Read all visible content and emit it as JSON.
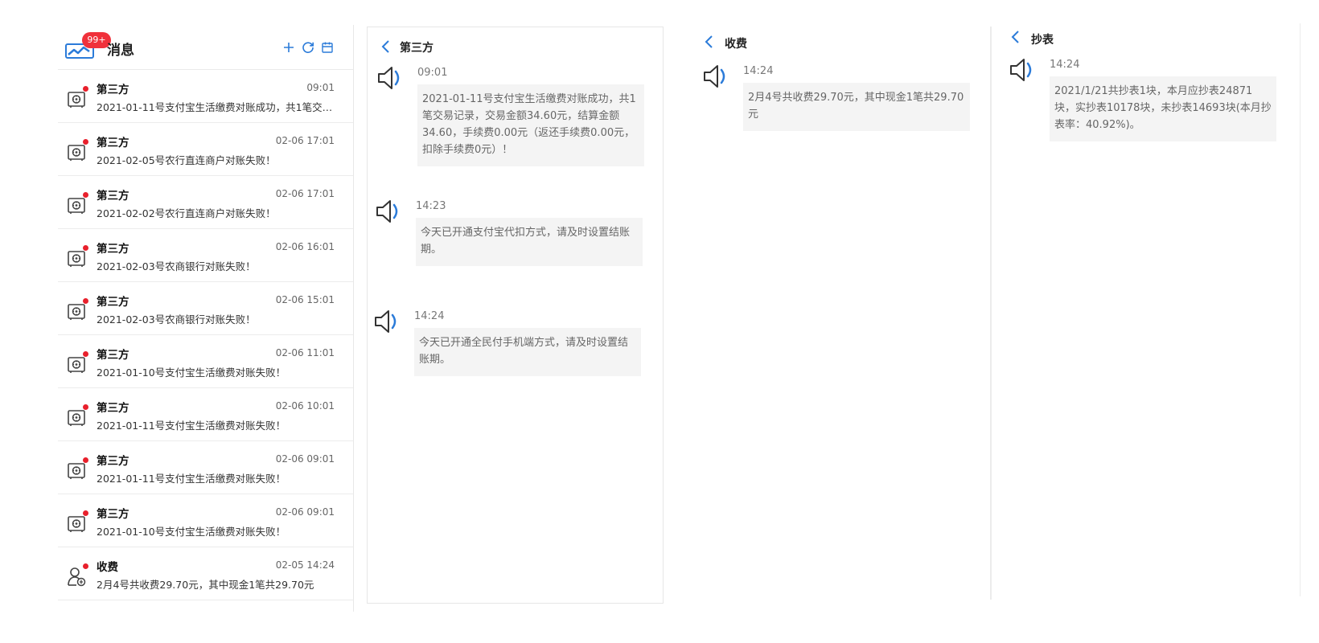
{
  "header": {
    "title": "消息",
    "unread_badge": "99+",
    "actions": [
      {
        "name": "add-button",
        "icon": "plus-icon"
      },
      {
        "name": "refresh-button",
        "icon": "refresh-icon"
      },
      {
        "name": "calendar-button",
        "icon": "calendar-icon"
      }
    ]
  },
  "colors": {
    "accent": "#2b7bd9",
    "badge": "#f0313b",
    "unread_dot": "#e8202c",
    "bubble_bg": "#f4f4f4"
  },
  "messages": [
    {
      "title": "第三方",
      "time": "09:01",
      "text": "2021-01-11号支付宝生活缴费对账成功，共1笔交易记录，交易金额34.60元，结算金额34.60，手续费0.00元（返还手续费0.00元，扣除手续费0元）！",
      "icon": "safe-icon"
    },
    {
      "title": "第三方",
      "time": "02-06 17:01",
      "text": "2021-02-05号农行直连商户对账失败！",
      "icon": "safe-icon"
    },
    {
      "title": "第三方",
      "time": "02-06 17:01",
      "text": "2021-02-02号农行直连商户对账失败！",
      "icon": "safe-icon"
    },
    {
      "title": "第三方",
      "time": "02-06 16:01",
      "text": "2021-02-03号农商银行对账失败！",
      "icon": "safe-icon"
    },
    {
      "title": "第三方",
      "time": "02-06 15:01",
      "text": "2021-02-03号农商银行对账失败！",
      "icon": "safe-icon"
    },
    {
      "title": "第三方",
      "time": "02-06 11:01",
      "text": "2021-01-10号支付宝生活缴费对账失败！",
      "icon": "safe-icon"
    },
    {
      "title": "第三方",
      "time": "02-06 10:01",
      "text": "2021-01-11号支付宝生活缴费对账失败！",
      "icon": "safe-icon"
    },
    {
      "title": "第三方",
      "time": "02-06 09:01",
      "text": "2021-01-11号支付宝生活缴费对账失败！",
      "icon": "safe-icon"
    },
    {
      "title": "第三方",
      "time": "02-06 09:01",
      "text": "2021-01-10号支付宝生活缴费对账失败！",
      "icon": "safe-icon"
    },
    {
      "title": "收费",
      "time": "02-05 14:24",
      "text": "2月4号共收费29.70元，其中现金1笔共29.70元",
      "icon": "user-coin-icon"
    }
  ],
  "panels": [
    {
      "title": "第三方",
      "bubbles": [
        {
          "time": "09:01",
          "text": "2021-01-11号支付宝生活缴费对账成功，共1笔交易记录，交易金额34.60元，结算金额34.60，手续费0.00元（返还手续费0.00元，扣除手续费0元）！"
        },
        {
          "time": "14:23",
          "text": "今天已开通支付宝代扣方式，请及时设置结账期。"
        },
        {
          "time": "14:24",
          "text": "今天已开通全民付手机端方式，请及时设置结账期。"
        }
      ]
    },
    {
      "title": "收费",
      "bubbles": [
        {
          "time": "14:24",
          "text": "2月4号共收费29.70元，其中现金1笔共29.70元"
        }
      ]
    },
    {
      "title": "抄表",
      "bubbles": [
        {
          "time": "14:24",
          "text": "2021/1/21共抄表1块，本月应抄表24871块，实抄表10178块，未抄表14693块(本月抄表率：40.92%)。"
        }
      ]
    }
  ]
}
